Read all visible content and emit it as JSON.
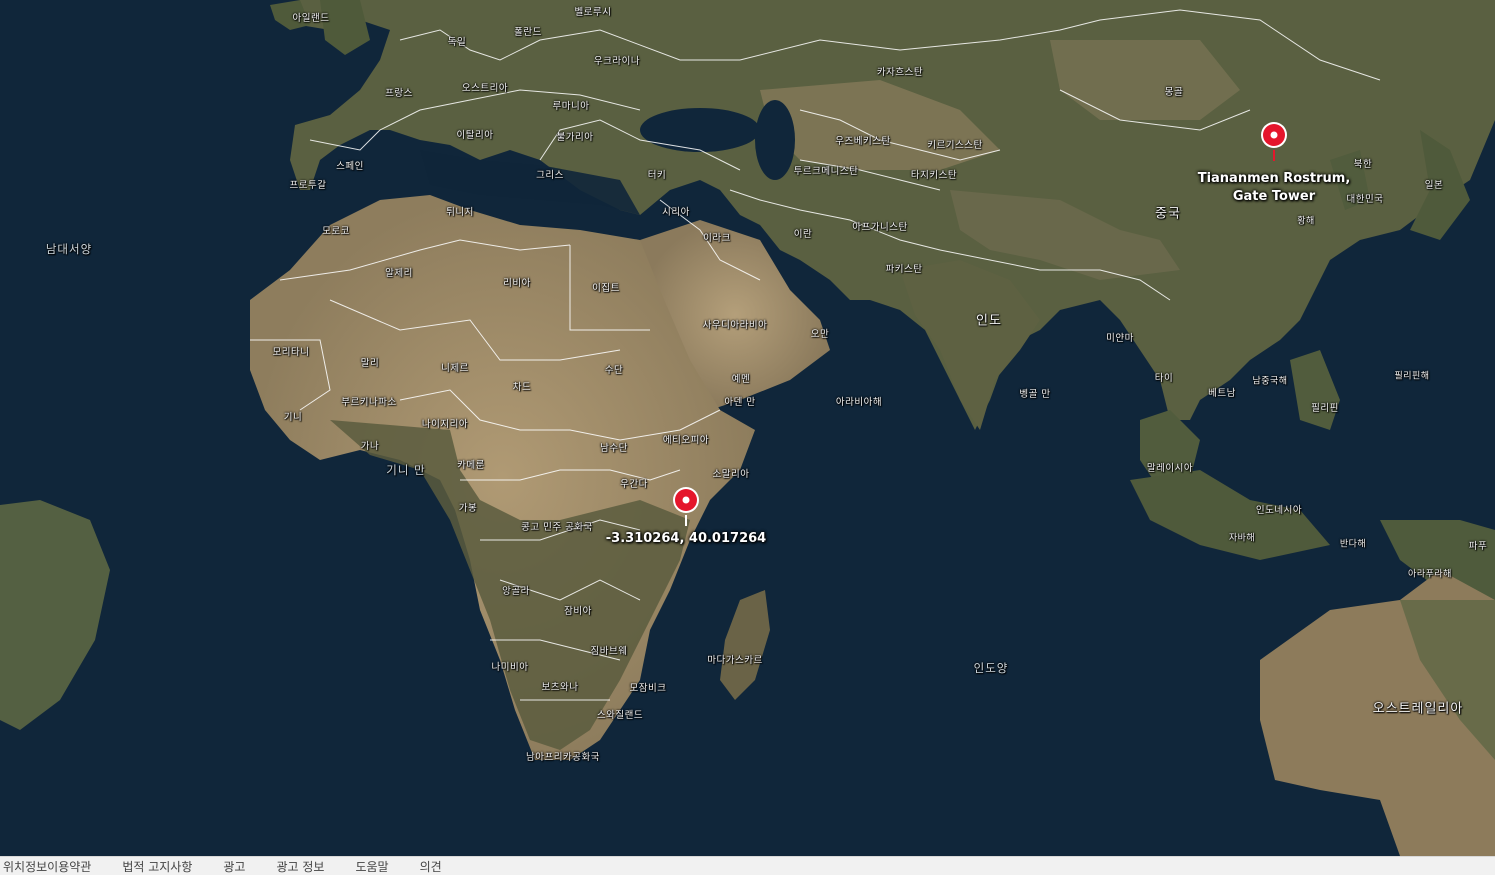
{
  "map": {
    "view": "aerial",
    "colors": {
      "ocean": "#0f2434",
      "land": "#6b6a4e",
      "desert": "#a89471",
      "border": "#ffffff",
      "pin": "#e5162c"
    },
    "labels": {
      "ireland": "아일랜드",
      "belarus": "벨로루시",
      "germany": "독일",
      "poland": "폴란드",
      "ukraine": "우크라이나",
      "france": "프랑스",
      "austria": "오스트리아",
      "romania": "루마니아",
      "italy": "이탈리아",
      "bulgaria": "불가리아",
      "spain": "스페인",
      "portugal": "프로투갈",
      "greece": "그리스",
      "turkey": "터키",
      "kazakhstan": "카자흐스탄",
      "mongolia": "몽골",
      "uzbekistan": "우즈베키스탄",
      "kyrgyzstan": "키르기스스탄",
      "turkmenistan": "투르크메니스탄",
      "tajikistan": "타지키스탄",
      "china": "중국",
      "north_korea": "북한",
      "south_korea": "대한민국",
      "japan": "일본",
      "yellow_sea": "황해",
      "syria": "시리아",
      "iraq": "이라크",
      "iran": "이란",
      "afghanistan": "아프가니스탄",
      "pakistan": "파키스탄",
      "india": "인도",
      "tunisia": "튀니지",
      "morocco": "모로코",
      "algeria": "알제리",
      "libya": "리비아",
      "egypt": "이집트",
      "saudi_arabia": "사우디아라비아",
      "oman": "오만",
      "yemen": "예멘",
      "gulf_of_aden": "아덴 만",
      "arabian_sea": "아라비아해",
      "bay_of_bengal": "벵골 만",
      "myanmar": "미얀마",
      "thailand": "타이",
      "vietnam": "베트남",
      "south_china_sea": "남중국해",
      "philippine_sea": "필리핀해",
      "philippines": "필리핀",
      "malaysia": "말레이시아",
      "indonesia": "인도네시아",
      "java_sea": "자바해",
      "banda_sea": "반다해",
      "papua": "파푸",
      "arafura_sea": "아라푸라해",
      "australia": "오스트레일리아",
      "south_atlantic": "남대서양",
      "mauritania": "모리타니",
      "mali": "말리",
      "niger": "니제르",
      "chad": "차드",
      "sudan": "수단",
      "burkina_faso": "부르키나파소",
      "guinea": "기니",
      "ghana": "가나",
      "nigeria": "나이지리아",
      "gulf_of_guinea": "기니 만",
      "cameroon": "카메룬",
      "south_sudan": "남수단",
      "ethiopia": "에티오피아",
      "somalia": "소말리아",
      "uganda": "우간다",
      "gabon": "가봉",
      "drc": "콩고 민주 공화국",
      "angola": "앙골라",
      "zambia": "잠비아",
      "zimbabwe": "짐바브웨",
      "namibia": "나미비아",
      "botswana": "보츠와나",
      "mozambique": "모잠비크",
      "eswatini": "스와질랜드",
      "south_africa": "남아프리카공화국",
      "madagascar": "마다가스카르",
      "indian_ocean": "인도양"
    },
    "pins": [
      {
        "label_line1": "Tiananmen Rostrum,",
        "label_line2": "Gate Tower"
      },
      {
        "label_line1": "-3.310264, 40.017264",
        "label_line2": ""
      }
    ]
  },
  "footer": {
    "links": [
      "위치정보이용약관",
      "법적 고지사항",
      "광고",
      "광고 정보",
      "도움말",
      "의견"
    ]
  }
}
